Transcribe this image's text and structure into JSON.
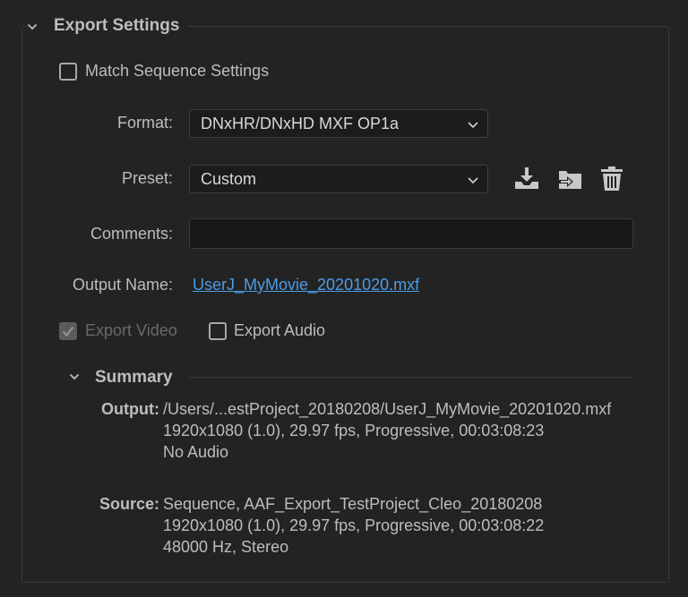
{
  "export_settings": {
    "title": "Export Settings",
    "match_sequence": {
      "label": "Match Sequence Settings",
      "checked": false
    },
    "format": {
      "label": "Format:",
      "value": "DNxHR/DNxHD MXF OP1a"
    },
    "preset": {
      "label": "Preset:",
      "value": "Custom"
    },
    "comments": {
      "label": "Comments:",
      "value": ""
    },
    "output_name": {
      "label": "Output Name:",
      "value": "UserJ_MyMovie_20201020.mxf"
    },
    "export_video": {
      "label": "Export Video",
      "checked": true,
      "disabled": true
    },
    "export_audio": {
      "label": "Export Audio",
      "checked": false
    }
  },
  "summary": {
    "title": "Summary",
    "output": {
      "label": "Output:",
      "lines": [
        "/Users/...estProject_20180208/UserJ_MyMovie_20201020.mxf",
        "1920x1080 (1.0), 29.97 fps, Progressive, 00:03:08:23",
        "No Audio"
      ]
    },
    "source": {
      "label": "Source:",
      "lines": [
        "Sequence, AAF_Export_TestProject_Cleo_20180208",
        "1920x1080 (1.0), 29.97 fps, Progressive, 00:03:08:22",
        "48000 Hz, Stereo"
      ]
    }
  },
  "icons": {
    "save_preset": "download-icon",
    "import_preset": "import-icon",
    "delete_preset": "trash-icon"
  },
  "colors": {
    "background": "#232323",
    "text": "#bdbdbd",
    "link": "#4d9ce6",
    "field_bg": "#1c1c1c"
  }
}
